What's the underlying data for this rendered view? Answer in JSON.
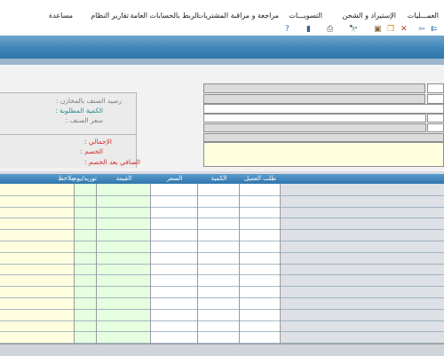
{
  "menu": {
    "items": [
      {
        "id": "operations",
        "label": "العمـــليات"
      },
      {
        "id": "import",
        "label": "الإستيراد و الشحن"
      },
      {
        "id": "settlements",
        "label": "التسويـــات"
      },
      {
        "id": "purchases",
        "label": "مراجعة و مراقبة المشتريات"
      },
      {
        "id": "accounts",
        "label": "الربط بالحسابات العامة"
      },
      {
        "id": "reports",
        "label": "تقارير النظام"
      },
      {
        "id": "help",
        "label": "مساعدة"
      }
    ]
  },
  "toolbar": {
    "icons": [
      "double-arrow-left-icon",
      "arrow-left-icon",
      "close-icon",
      "copy-icon",
      "paste-icon",
      "search-binoculars-icon",
      "print-icon",
      "exit-door-icon",
      "help-icon"
    ]
  },
  "form": {
    "stock_label": "رصيد الصنف بالمخازن :",
    "qty_label": "الكمية المطلوبة :",
    "price_label": "سعر الصنف :",
    "total_label": "الإجمالي :",
    "discount_label": "الخصم :",
    "net_label": "الصافي بعد الخصم :"
  },
  "table": {
    "headers": {
      "request": "طلب العميل",
      "qty": "الكمية",
      "price": "السعر",
      "value": "القيمة",
      "supply": "توريد/يوم",
      "notes": "ملاحظ"
    },
    "row_count": 14
  },
  "colors": {
    "banner": "#3f85b8",
    "header": "#2f76ad",
    "yellow_cell": "#ffffe0",
    "green_cell": "#e6ffe0"
  }
}
